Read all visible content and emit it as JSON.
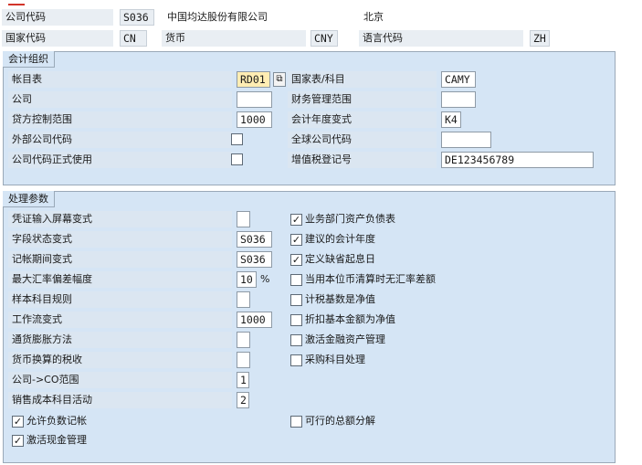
{
  "header": {
    "company_code_label": "公司代码",
    "company_code": "S036",
    "company_name": "中国均达股份有限公司",
    "city": "北京",
    "country_label": "国家代码",
    "country": "CN",
    "currency_label": "货币",
    "currency": "CNY",
    "language_label": "语言代码",
    "language": "ZH"
  },
  "accounting": {
    "title": "会计组织",
    "chart_of_accounts_label": "帐目表",
    "chart_of_accounts": "RD01",
    "country_chart_label": "国家表/科目",
    "country_chart": "CAMY",
    "company_label": "公司",
    "company": "",
    "fm_area_label": "财务管理范围",
    "fm_area": "",
    "credit_control_label": "贷方控制范围",
    "credit_control": "1000",
    "fiscal_year_variant_label": "会计年度变式",
    "fiscal_year_variant": "K4",
    "external_cc_label": "外部公司代码",
    "external_cc_checked": false,
    "global_cc_label": "全球公司代码",
    "global_cc": "",
    "cc_productive_label": "公司代码正式使用",
    "cc_productive_checked": false,
    "vat_reg_label": "增值税登记号",
    "vat_reg": "DE123456789"
  },
  "processing": {
    "title": "处理参数",
    "left": [
      {
        "label": "凭证输入屏幕变式",
        "value": ""
      },
      {
        "label": "字段状态变式",
        "value": "S036"
      },
      {
        "label": "记帐期间变式",
        "value": "S036"
      },
      {
        "label": "最大汇率偏差幅度",
        "value": "10",
        "unit": "%"
      },
      {
        "label": "样本科目规则",
        "value": ""
      },
      {
        "label": "工作流变式",
        "value": "1000"
      },
      {
        "label": "通货膨胀方法",
        "value": ""
      },
      {
        "label": "货币换算的税收",
        "value": ""
      },
      {
        "label": "公司->CO范围",
        "value": "1"
      },
      {
        "label": "销售成本科目活动",
        "value": "2"
      }
    ],
    "right": [
      {
        "label": "业务部门资产负债表",
        "checked": true
      },
      {
        "label": "建议的会计年度",
        "checked": true
      },
      {
        "label": "定义缺省起息日",
        "checked": true
      },
      {
        "label": "当用本位币清算时无汇率差额",
        "checked": false
      },
      {
        "label": "计税基数是净值",
        "checked": false
      },
      {
        "label": "折扣基本金额为净值",
        "checked": false
      },
      {
        "label": "激活金融资产管理",
        "checked": false
      },
      {
        "label": "采购科目处理",
        "checked": false
      }
    ],
    "negative_postings_label": "允许负数记帐",
    "negative_postings_checked": true,
    "cash_mgmt_label": "激活现金管理",
    "cash_mgmt_checked": true,
    "feasible_split_label": "可行的总额分解",
    "feasible_split_checked": false
  },
  "glyphs": {
    "check": "✓",
    "f4": "⧉"
  }
}
